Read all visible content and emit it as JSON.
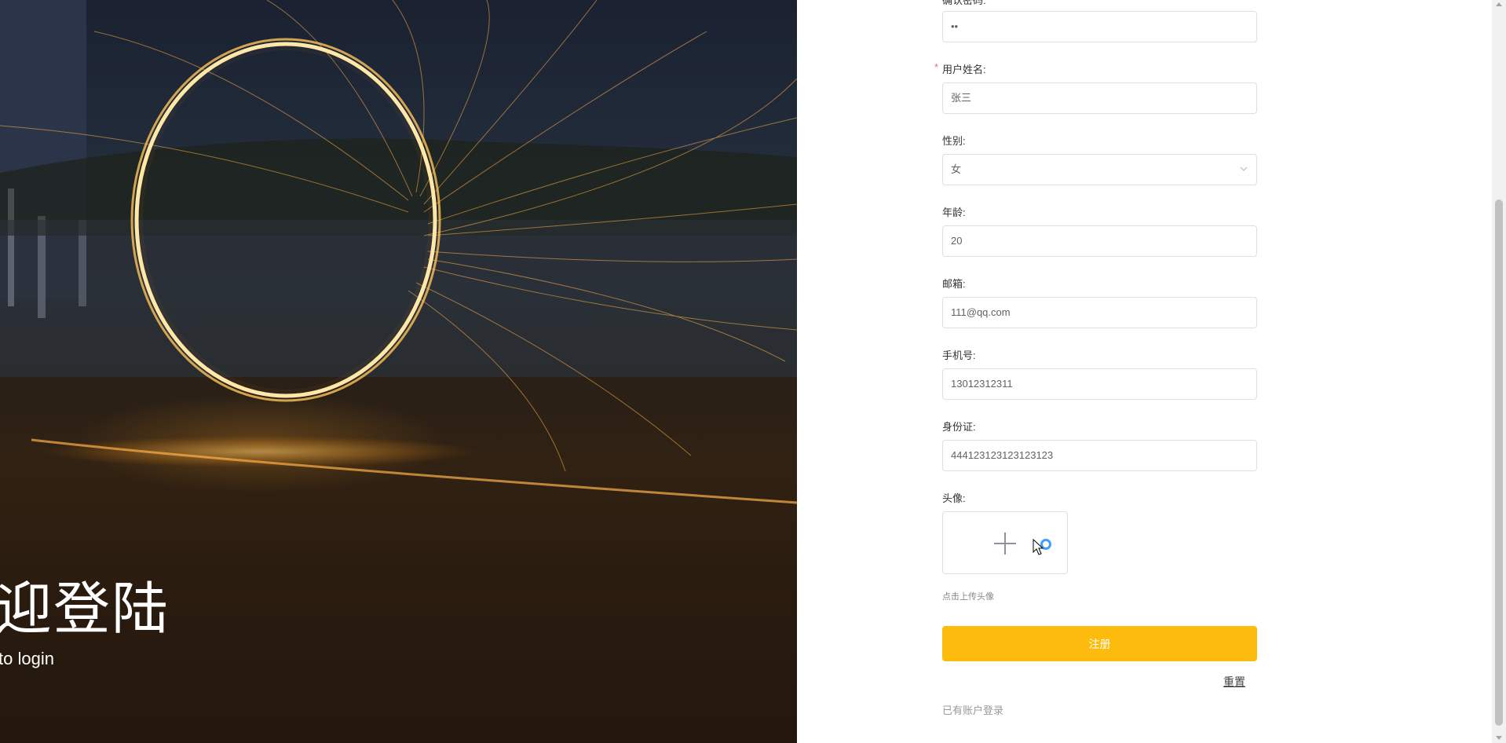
{
  "hero": {
    "title": "迎登陆",
    "subtitle": "to login"
  },
  "form": {
    "fields": [
      {
        "label": "确认密码:",
        "value": "••",
        "type": "password"
      },
      {
        "label": "用户姓名:",
        "value": "张三",
        "required": true
      },
      {
        "label": "性别:",
        "value": "女",
        "type": "select"
      },
      {
        "label": "年龄:",
        "value": "20"
      },
      {
        "label": "邮箱:",
        "value": "111@qq.com"
      },
      {
        "label": "手机号:",
        "value": "13012312311"
      },
      {
        "label": "身份证:",
        "value": "444123123123123123"
      }
    ],
    "avatar_label": "头像:",
    "avatar_hint": "点击上传头像",
    "submit_label": "注册",
    "reset_label": "重置",
    "login_link": "已有账户登录",
    "required_mark": "*"
  },
  "icons": {
    "upload": "plus-icon",
    "select": "chevron-down-icon",
    "cursor": "mouse-cursor-icon"
  },
  "colors": {
    "accent": "#fdbb0d",
    "required": "#f56c6c",
    "border": "#dcdfe6",
    "loading": "#409eff"
  }
}
